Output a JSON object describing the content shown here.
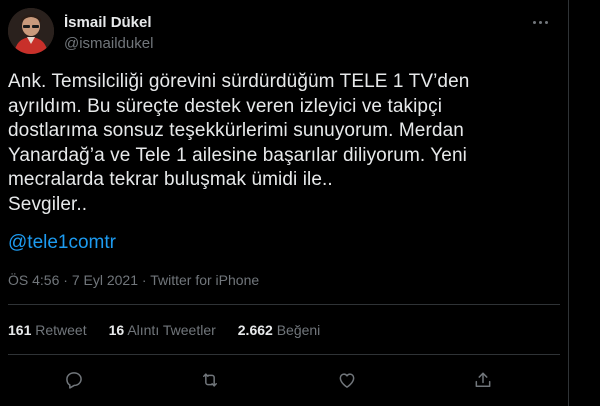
{
  "author": {
    "name": "İsmail Dükel",
    "handle": "@ismaildukel"
  },
  "tweet": {
    "text": "Ank. Temsilciliği görevini sürdürdüğüm TELE 1 TV’den\nayrıldım. Bu süreçte destek veren izleyici ve takipçi\ndostlarıma sonsuz teşekkürlerimi sunuyorum.  Merdan\nYanardağ’a ve Tele 1 ailesine başarılar diliyorum. Yeni\nmecralarda tekrar buluşmak ümidi ile..\nSevgiler..",
    "mention": "@tele1comtr",
    "time": "ÖS 4:56",
    "separator": "·",
    "date": "7 Eyl 2021",
    "source": "Twitter for iPhone"
  },
  "stats": {
    "retweets": {
      "count": "161",
      "label": "Retweet"
    },
    "quotes": {
      "count": "16",
      "label": "Alıntı Tweetler"
    },
    "likes": {
      "count": "2.662",
      "label": "Beğeni"
    }
  },
  "icons": {
    "more": "more-dots-icon",
    "reply": "reply-icon",
    "retweet": "retweet-icon",
    "like": "heart-icon",
    "share": "share-icon"
  },
  "colors": {
    "background": "#000000",
    "text": "#e7e9ea",
    "muted": "#71767b",
    "link": "#1d9bf0",
    "border": "#2f3336"
  }
}
